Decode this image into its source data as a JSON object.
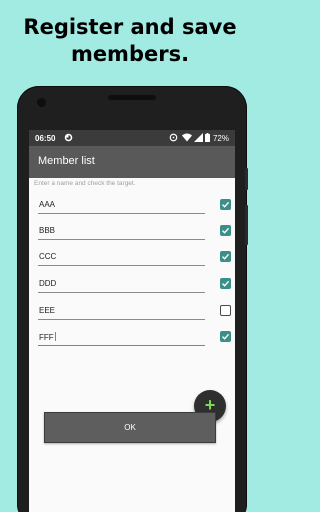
{
  "promo": {
    "headline_line1": "Register and save",
    "headline_line2": "members."
  },
  "statusbar": {
    "time": "06:50",
    "battery": "72%"
  },
  "appbar": {
    "title": "Member list"
  },
  "hint": "Enter a name and check the target.",
  "members": [
    {
      "name": "AAA",
      "checked": true
    },
    {
      "name": "BBB",
      "checked": true
    },
    {
      "name": "CCC",
      "checked": true
    },
    {
      "name": "DDD",
      "checked": true
    },
    {
      "name": "EEE",
      "checked": false
    },
    {
      "name": "FFF",
      "checked": true
    }
  ],
  "fab": {
    "symbol": "+"
  },
  "ok_button": {
    "label": "OK"
  },
  "colors": {
    "background": "#a2ebe3",
    "accent": "#3a8f89",
    "appbar": "#595959",
    "fab_plus": "#7ed957"
  }
}
